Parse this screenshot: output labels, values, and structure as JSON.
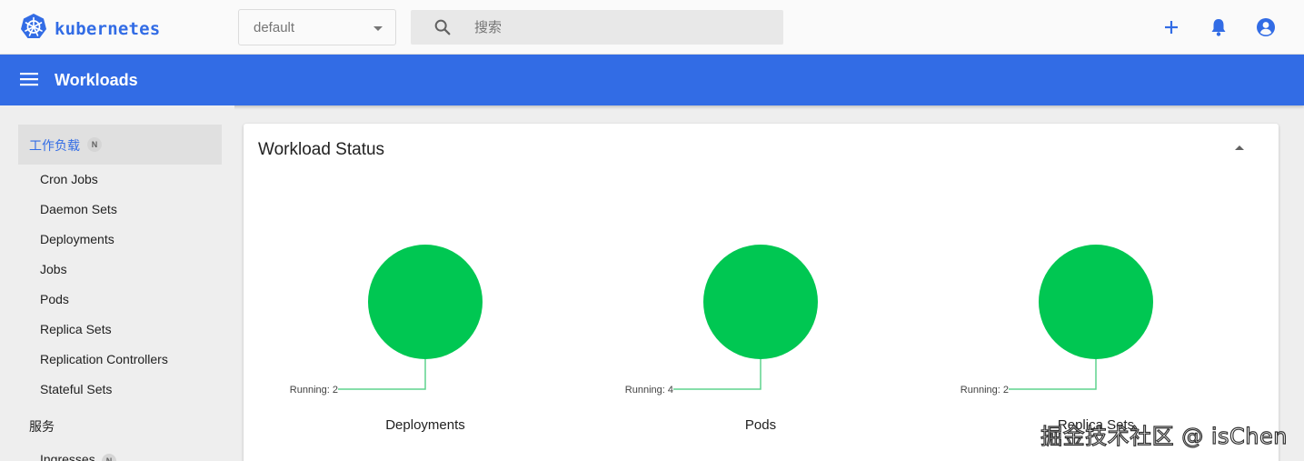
{
  "app": {
    "name": "kubernetes"
  },
  "namespace": {
    "selected": "default"
  },
  "search": {
    "placeholder": "搜索"
  },
  "actions": [
    {
      "name": "create",
      "icon": "add-icon"
    },
    {
      "name": "notifications",
      "icon": "bell-icon"
    },
    {
      "name": "account",
      "icon": "account-circle-icon"
    }
  ],
  "header": {
    "title": "Workloads",
    "menu_icon": "menu-icon"
  },
  "sidebar": {
    "workloads_section": {
      "label": "工作负载",
      "badge": "N"
    },
    "items": [
      {
        "label": "Cron Jobs"
      },
      {
        "label": "Daemon Sets"
      },
      {
        "label": "Deployments"
      },
      {
        "label": "Jobs"
      },
      {
        "label": "Pods"
      },
      {
        "label": "Replica Sets"
      },
      {
        "label": "Replication Controllers"
      },
      {
        "label": "Stateful Sets"
      }
    ],
    "services_section": {
      "label": "服务"
    },
    "services_items": [
      {
        "label": "Ingresses",
        "badge": "N"
      }
    ]
  },
  "card": {
    "title": "Workload Status",
    "collapse_icon": "arrow-drop-up-icon"
  },
  "colors": {
    "brand": "#326ce5",
    "running": "#00c752",
    "running_line": "#5fd38d"
  },
  "chart_data": [
    {
      "type": "pie",
      "title": "Deployments",
      "slices": [
        {
          "label": "Running",
          "value": 2,
          "color": "#00c752"
        }
      ],
      "annotation": "Running: 2"
    },
    {
      "type": "pie",
      "title": "Pods",
      "slices": [
        {
          "label": "Running",
          "value": 4,
          "color": "#00c752"
        }
      ],
      "annotation": "Running: 4"
    },
    {
      "type": "pie",
      "title": "Replica Sets",
      "slices": [
        {
          "label": "Running",
          "value": 2,
          "color": "#00c752"
        }
      ],
      "annotation": "Running: 2"
    }
  ],
  "watermark": "掘金技术社区 @ isChen"
}
